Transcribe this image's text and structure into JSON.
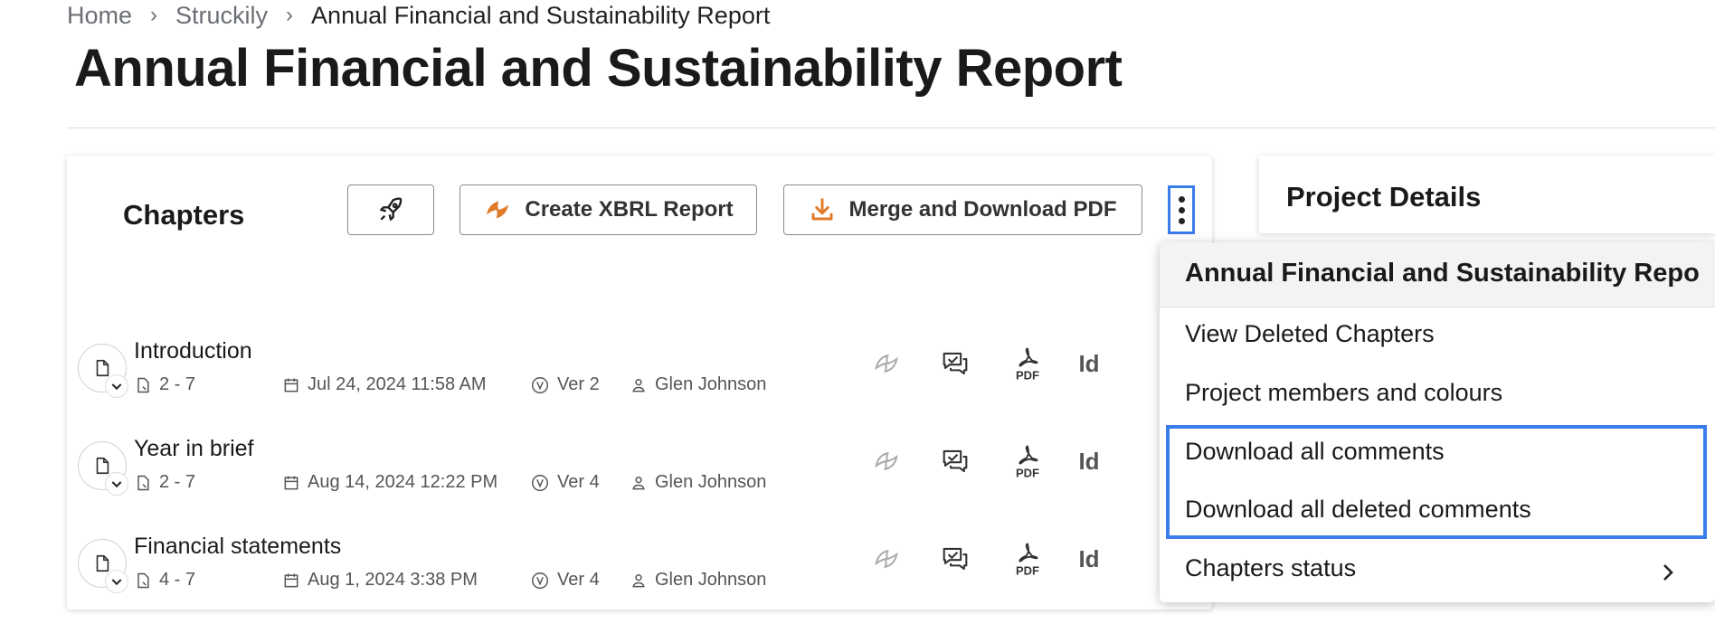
{
  "breadcrumb": {
    "home": "Home",
    "sep": "›",
    "project": "Struckily",
    "current": "Annual Financial and Sustainability Report"
  },
  "page": {
    "title": "Annual Financial and Sustainability Report"
  },
  "chapters": {
    "title": "Chapters",
    "buttons": {
      "xbrl": "Create XBRL Report",
      "merge": "Merge and Download PDF"
    },
    "rows": [
      {
        "name": "Introduction",
        "pages": "2 - 7",
        "date": "Jul 24, 2024 11:58 AM",
        "version": "Ver 2",
        "user": "Glen Johnson",
        "pdf": "PDF",
        "id": "Id"
      },
      {
        "name": "Year in brief",
        "pages": "2 - 7",
        "date": "Aug 14, 2024 12:22 PM",
        "version": "Ver 4",
        "user": "Glen Johnson",
        "pdf": "PDF",
        "id": "Id"
      },
      {
        "name": "Financial statements",
        "pages": "4 - 7",
        "date": "Aug 1, 2024 3:38 PM",
        "version": "Ver 4",
        "user": "Glen Johnson",
        "pdf": "PDF",
        "id": "Id"
      }
    ]
  },
  "details": {
    "title": "Project Details"
  },
  "menu": {
    "header": "Annual Financial and Sustainability Repo",
    "items": [
      "View Deleted Chapters",
      "Project members and colours",
      "Download all comments",
      "Download all deleted comments",
      "Chapters status"
    ]
  },
  "colors": {
    "accent": "#3b7dea",
    "orange": "#e07b2a"
  }
}
